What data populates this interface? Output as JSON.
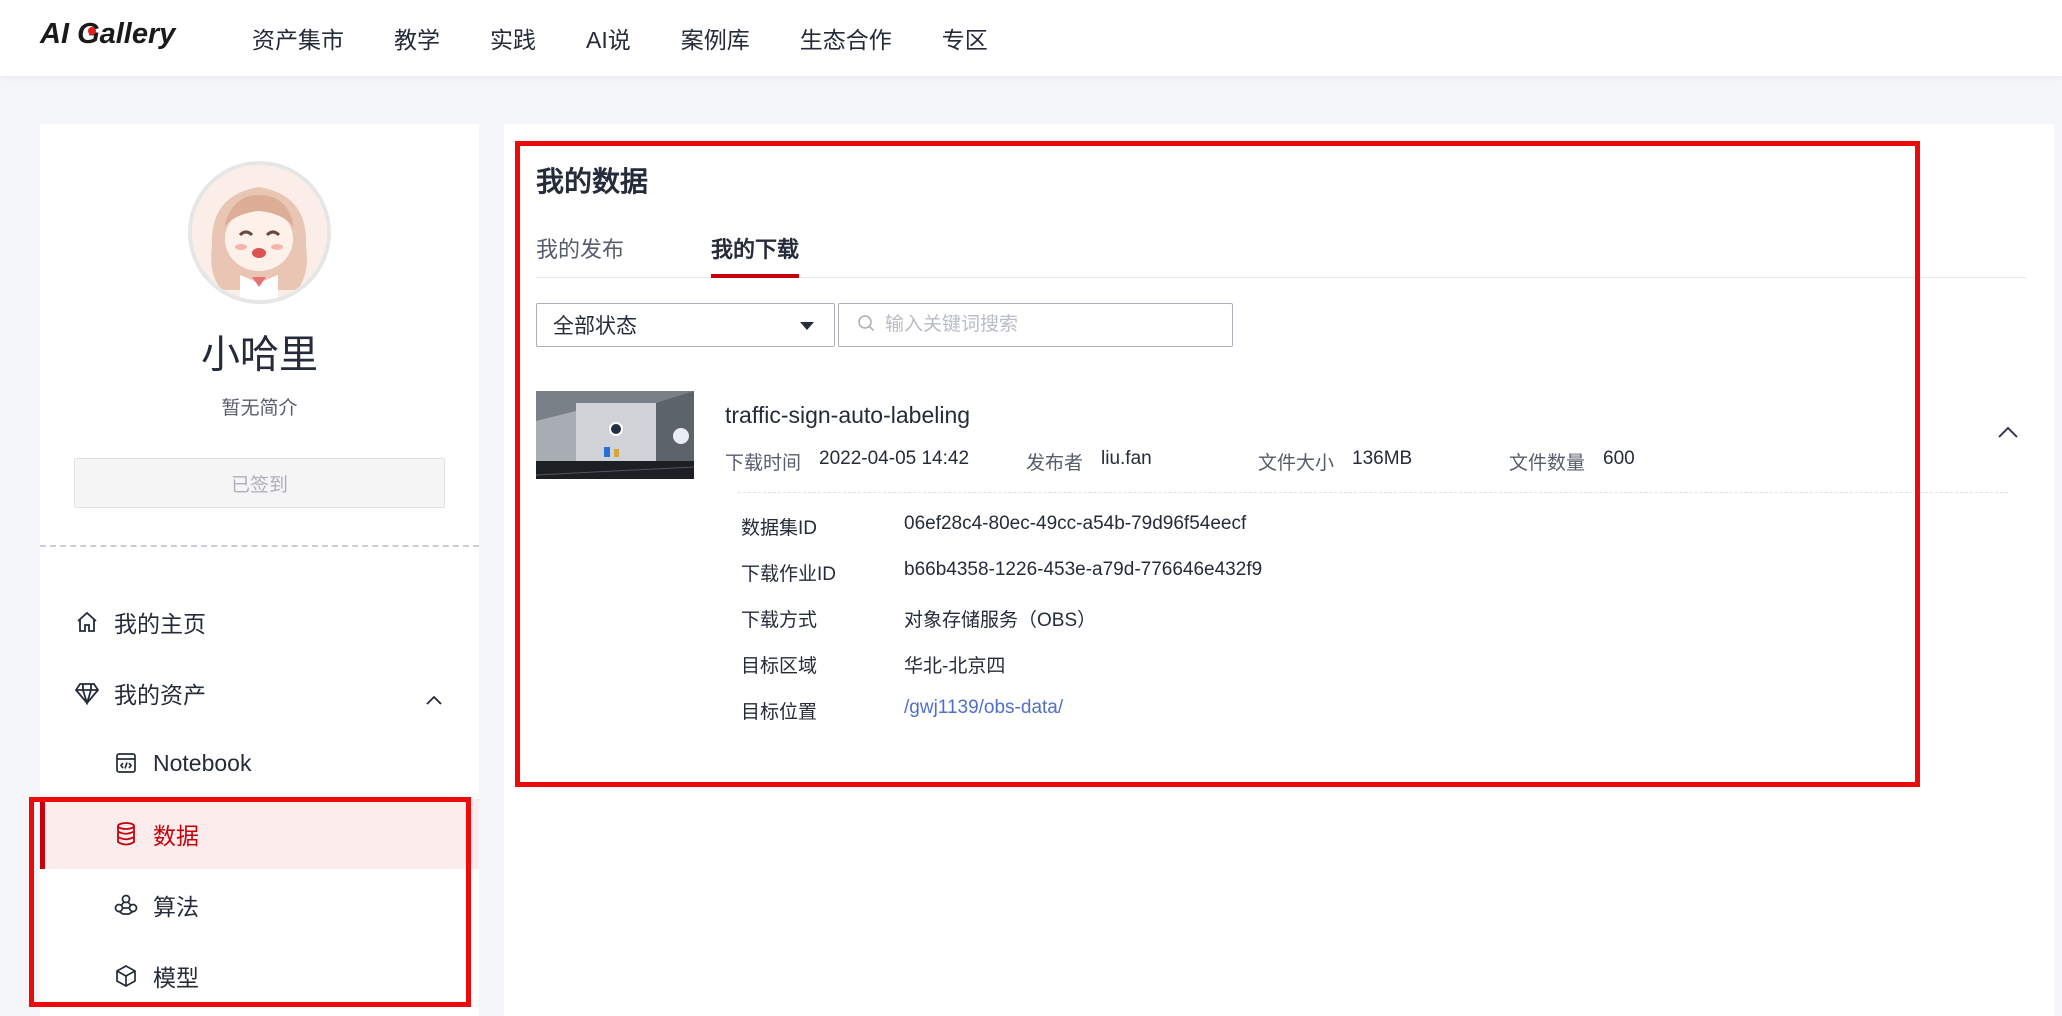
{
  "header": {
    "logo": "AI Gallery",
    "nav": [
      "资产集市",
      "教学",
      "实践",
      "AI说",
      "案例库",
      "生态合作",
      "专区"
    ]
  },
  "profile": {
    "name": "小哈里",
    "bio": "暂无简介",
    "checkin_label": "已签到"
  },
  "sidebar": {
    "home": "我的主页",
    "assets": "我的资产",
    "sub": {
      "notebook": "Notebook",
      "data": "数据",
      "algorithm": "算法",
      "model": "模型"
    }
  },
  "main": {
    "title": "我的数据",
    "tabs": {
      "published": "我的发布",
      "downloaded": "我的下载"
    },
    "filter": {
      "status_value": "全部状态",
      "search_placeholder": "输入关键词搜索"
    },
    "item": {
      "name": "traffic-sign-auto-labeling",
      "meta": {
        "download_time_label": "下载时间",
        "download_time": "2022-04-05 14:42",
        "publisher_label": "发布者",
        "publisher": "liu.fan",
        "size_label": "文件大小",
        "size": "136MB",
        "count_label": "文件数量",
        "count": "600"
      },
      "details": {
        "dataset_id_label": "数据集ID",
        "dataset_id": "06ef28c4-80ec-49cc-a54b-79d96f54eecf",
        "job_id_label": "下载作业ID",
        "job_id": "b66b4358-1226-453e-a79d-776646e432f9",
        "method_label": "下载方式",
        "method": "对象存储服务（OBS）",
        "region_label": "目标区域",
        "region": "华北-北京四",
        "location_label": "目标位置",
        "location": "/gwj1139/obs-data/"
      }
    }
  },
  "colors": {
    "accent": "#c7000b",
    "highlight": "#ec0a0a",
    "link": "#526ecc"
  }
}
